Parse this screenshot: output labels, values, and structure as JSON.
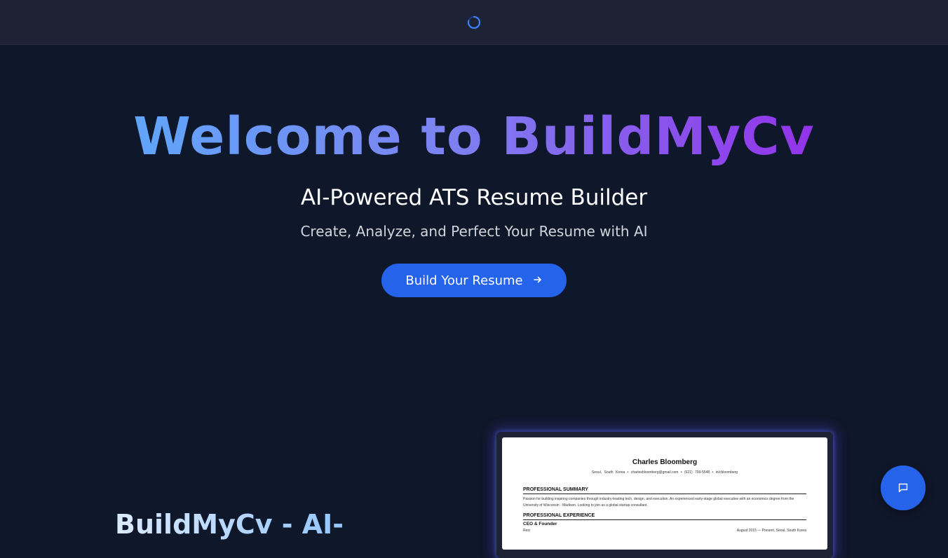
{
  "hero": {
    "title": "Welcome to BuildMyCv",
    "subtitle": "AI-Powered ATS Resume Builder",
    "tagline": "Create, Analyze, and Perfect Your Resume with AI",
    "cta_label": "Build Your Resume"
  },
  "section": {
    "title": "BuildMyCv - AI-"
  },
  "resume_preview": {
    "name": "Charles Bloomberg",
    "contact": "Seoul, South Korea  •  charlesbloomberg@gmail.com  •  (621) 799-5548  •  in/cbloomberg",
    "summary_heading": "PROFESSIONAL SUMMARY",
    "summary_text": "Passion for building inspiring companies through industry-leading tech, design, and execution. An experienced early-stage global executive with an economics degree from the University of Wisconsin - Madison. Looking to join as a global startup consultant.",
    "experience_heading": "PROFESSIONAL EXPERIENCE",
    "role": "CEO & Founder",
    "company": "Rezi",
    "dates": "August 2015 — Present,  Seoul, South Korea"
  },
  "icons": {
    "spinner": "loading-spinner-icon",
    "cta_arrow": "arrow-right-icon",
    "chat": "chat-bubble-icon"
  },
  "colors": {
    "background": "#0f172a",
    "topbar": "#1e2235",
    "primary": "#2563eb",
    "gradient_start": "#60a5fa",
    "gradient_end": "#9333ea"
  }
}
